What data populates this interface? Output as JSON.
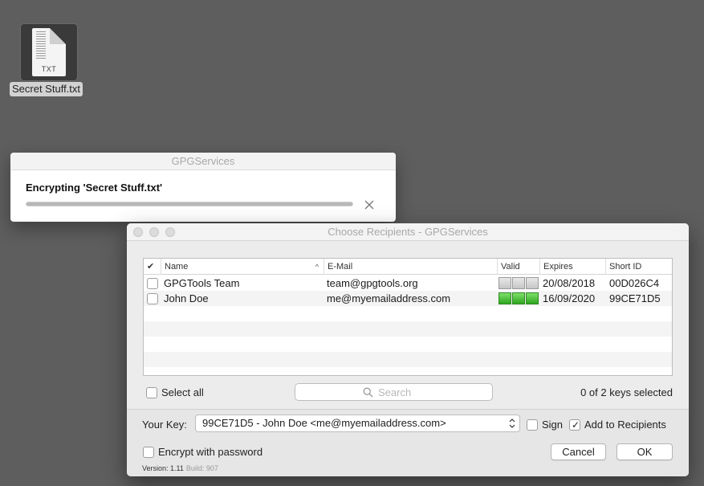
{
  "desktop": {
    "file_name": "Secret Stuff.txt",
    "file_ext": "TXT"
  },
  "progress_window": {
    "title": "GPGServices",
    "message": "Encrypting 'Secret Stuff.txt'",
    "progress": 1.0
  },
  "recipients_window": {
    "title": "Choose Recipients - GPGServices",
    "columns": {
      "check": "✔",
      "name": "Name",
      "email": "E-Mail",
      "valid": "Valid",
      "expires": "Expires",
      "short_id": "Short ID"
    },
    "rows": [
      {
        "name": "GPGTools Team",
        "email": "team@gpgtools.org",
        "valid": "invalid",
        "expires": "20/08/2018",
        "short_id": "00D026C4",
        "checked": false
      },
      {
        "name": "John Doe",
        "email": "me@myemailaddress.com",
        "valid": "valid",
        "expires": "16/09/2020",
        "short_id": "99CE71D5",
        "checked": false
      }
    ],
    "select_all_label": "Select all",
    "search_placeholder": "Search",
    "keys_selected": "0 of 2 keys selected",
    "your_key_label": "Your Key:",
    "your_key_value": "99CE71D5 - John Doe <me@myemailaddress.com>",
    "sign_label": "Sign",
    "add_to_recipients_label": "Add to Recipients",
    "encrypt_with_password_label": "Encrypt with password",
    "cancel_label": "Cancel",
    "ok_label": "OK",
    "version_label": "Version: 1.11",
    "build_label": "Build: 907"
  },
  "colors": {
    "desktop": "#5e5e5e",
    "valid_green": "#3fbf2c",
    "window_bg": "#ececec"
  }
}
